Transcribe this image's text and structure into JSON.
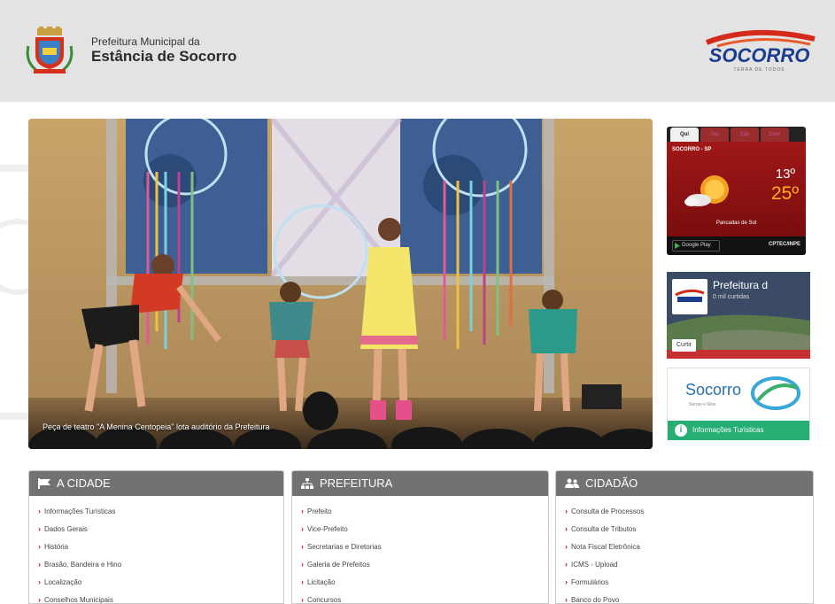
{
  "header": {
    "subtitle": "Prefeitura Municipal da",
    "title": "Estância de Socorro",
    "logo_text": "SOCORRO",
    "logo_tagline": "TERRA DE TODOS"
  },
  "hero": {
    "caption": "Peça de teatro \"A Menina Centopeia\" lota auditório da Prefeitura"
  },
  "weather": {
    "tabs": [
      "Qui",
      "Sex",
      "Sáb",
      "Dom"
    ],
    "active_tab": 0,
    "location": "SOCORRO - SP",
    "temp_max": "13º",
    "temp_min": "25º",
    "condition": "Pancadas de Sol",
    "store_label": "Google Play",
    "provider": "CPTEC/INPE"
  },
  "banner_prefeitura": {
    "title": "Prefeitura d",
    "subtitle": "0 mil curtidas",
    "button": "Curtir"
  },
  "banner_turismo": {
    "brand": "Socorro",
    "tagline": "Serras e Rios",
    "cta": "Informações Turísticas"
  },
  "columns": [
    {
      "icon": "flag-icon",
      "title": "A CIDADE",
      "items": [
        "Informações Turísticas",
        "Dados Gerais",
        "História",
        "Brasão, Bandeira e Hino",
        "Localização",
        "Conselhos Municipais"
      ]
    },
    {
      "icon": "sitemap-icon",
      "title": "PREFEITURA",
      "items": [
        "Prefeito",
        "Vice-Prefeito",
        "Secretarias e Diretorias",
        "Galeria de Prefeitos",
        "Licitação",
        "Concursos"
      ]
    },
    {
      "icon": "users-icon",
      "title": "CIDADÃO",
      "items": [
        "Consulta de Processos",
        "Consulta de Tributos",
        "Nota Fiscal Eletrônica",
        "ICMS - Upload",
        "Formulários",
        "Banco do Povo"
      ]
    }
  ],
  "colors": {
    "header_bg": "#e3e3e3",
    "column_header": "#727272",
    "chevron": "#c0201c",
    "weather_red": "#a01818",
    "tourism_green": "#27ae73",
    "logo_blue": "#1b3d8f"
  }
}
